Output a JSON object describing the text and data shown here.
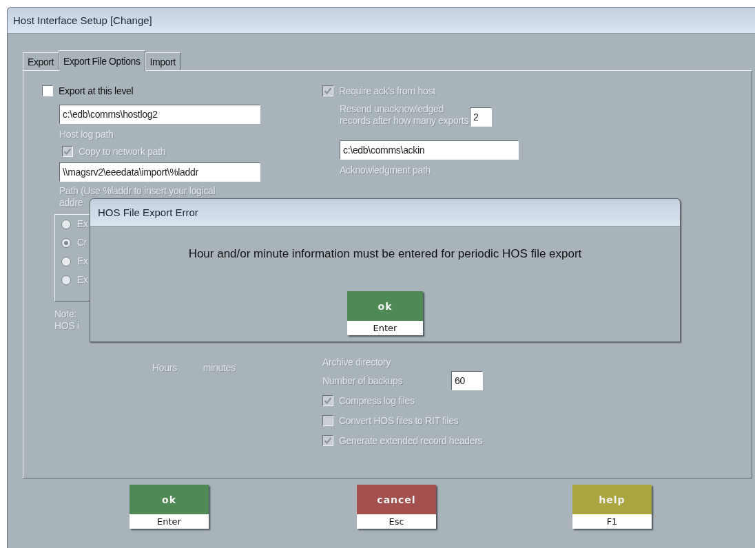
{
  "window": {
    "title": "Host Interface Setup  [Change]"
  },
  "tabs": [
    {
      "label": "Export",
      "selected": false
    },
    {
      "label": "Export File Options",
      "selected": true
    },
    {
      "label": "Import",
      "selected": false
    }
  ],
  "left": {
    "export_checkbox": {
      "label": "Export at this level",
      "checked": false,
      "disabled": false
    },
    "host_log_path": {
      "value": "c:\\edb\\comms\\hostlog2",
      "label": "Host log path"
    },
    "copy_checkbox": {
      "label": "Copy to network path",
      "checked": true,
      "disabled": true
    },
    "network_path": {
      "value": "\\\\magsrv2\\eeedata\\import\\%laddr"
    },
    "path_hint": [
      "Path (Use %laddr to insert your logical",
      "addre"
    ],
    "radios": [
      {
        "label": "Ex",
        "selected": false
      },
      {
        "label": "Cr",
        "selected": true
      },
      {
        "label": "Ex",
        "selected": false
      },
      {
        "label": "Ex",
        "selected": false
      }
    ],
    "note": [
      "Note:",
      "HOS i"
    ],
    "time_labels": [
      "Hours",
      "minutes"
    ]
  },
  "right": {
    "ack_checkbox": {
      "label": "Require ack's from host",
      "checked": true,
      "disabled": true
    },
    "resend_label": [
      "Resend unacknowledged",
      "records after how many exports"
    ],
    "resend_count": "2",
    "ack_path": {
      "value": "c:\\edb\\comms\\ackin",
      "label": "Acknowledgment path"
    },
    "archive_label": "Archive directory",
    "backups": {
      "label": "Number of backups",
      "value": "60"
    },
    "options": [
      {
        "label": "Compress log files",
        "checked": true,
        "disabled": true
      },
      {
        "label": "Convert HOS files to RIT files",
        "checked": false,
        "disabled": true
      },
      {
        "label": "Generate extended record headers",
        "checked": true,
        "disabled": true
      }
    ]
  },
  "buttons": [
    {
      "kind": "ok",
      "label": "ok",
      "key": "Enter"
    },
    {
      "kind": "cancel",
      "label": "cancel",
      "key": "Esc"
    },
    {
      "kind": "help",
      "label": "help",
      "key": "F1"
    }
  ],
  "dialog": {
    "title": "HOS File Export Error",
    "message": "Hour and/or minute information must be entered for periodic HOS file export",
    "button": {
      "kind": "ok",
      "label": "ok",
      "key": "Enter"
    }
  }
}
